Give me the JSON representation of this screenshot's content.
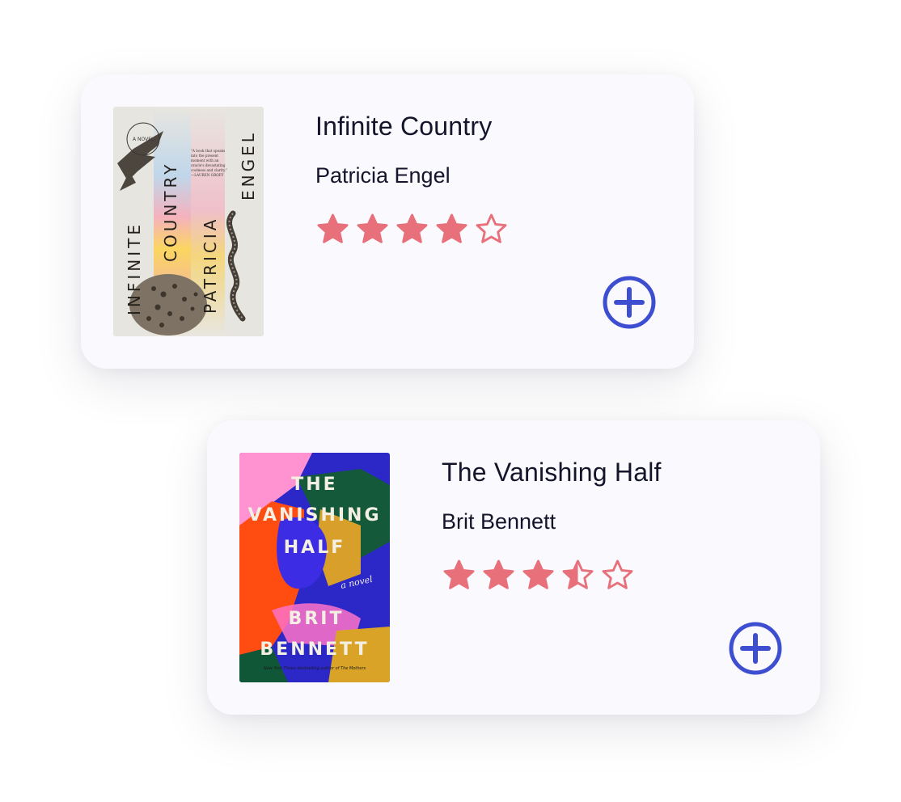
{
  "books": [
    {
      "title": "Infinite Country",
      "author": "Patricia Engel",
      "rating": 4,
      "max_rating": 5,
      "cover": {
        "label": "A NOVEL",
        "words": [
          "INFINITE",
          "COUNTRY",
          "PATRICIA",
          "ENGEL"
        ],
        "blurb": [
          "\"A book that speaks",
          "into the present",
          "moment with an",
          "oracle's devastating",
          "coolness and clarity.\"",
          "—LAUREN GROFF"
        ]
      },
      "add_icon": "plus-circle-icon"
    },
    {
      "title": "The Vanishing Half",
      "author": "Brit Bennett",
      "rating": 3.5,
      "max_rating": 5,
      "cover": {
        "title_lines": [
          "THE",
          "VANISHING",
          "HALF"
        ],
        "tagline": "a novel",
        "author_lines": [
          "BRIT",
          "BENNETT"
        ],
        "footer": "New York Times–bestselling author of The Mothers"
      },
      "add_icon": "plus-circle-icon"
    }
  ],
  "colors": {
    "card_bg": "#f9f9fe",
    "star": "#e8707a",
    "accent": "#3d4ed1",
    "text": "#14142b"
  }
}
